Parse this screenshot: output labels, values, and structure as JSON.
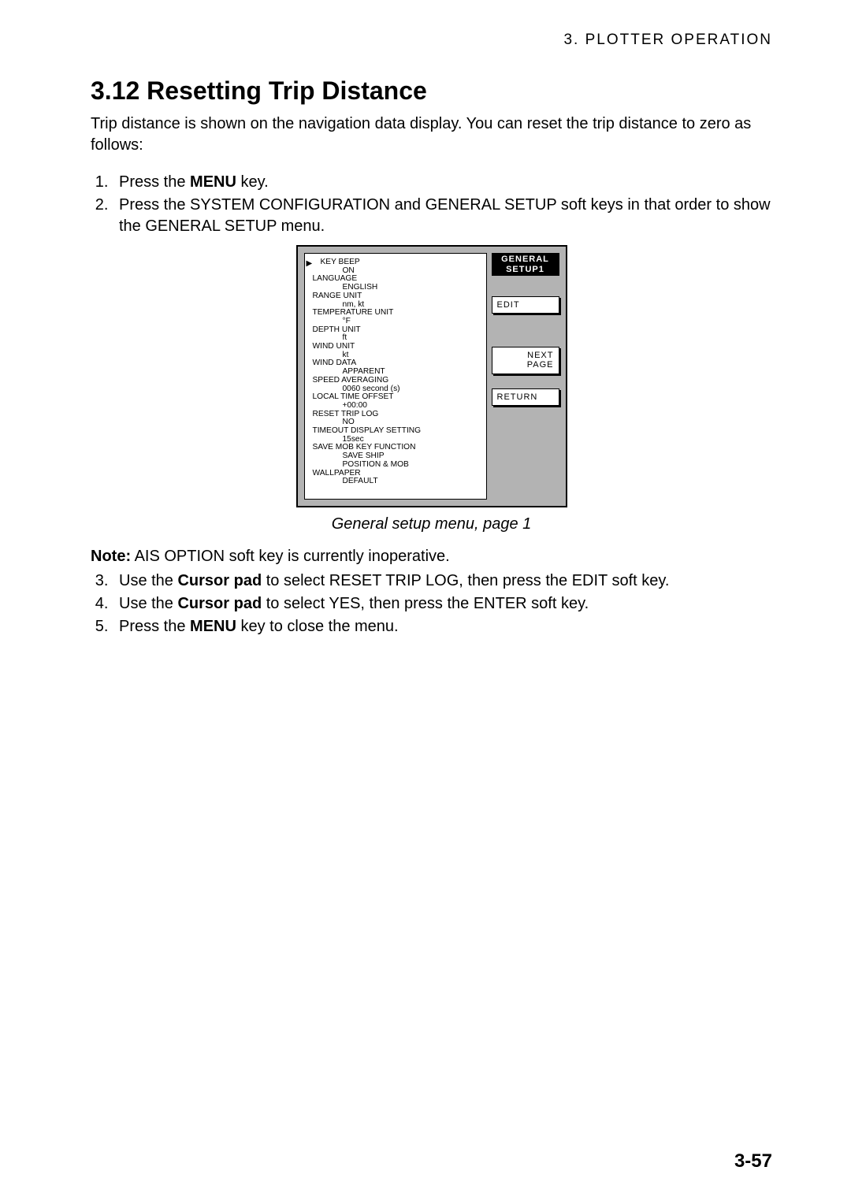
{
  "header": {
    "running": "3. PLOTTER OPERATION"
  },
  "section": {
    "heading": "3.12  Resetting Trip Distance",
    "intro": "Trip distance is shown on the navigation data display. You can reset the trip distance to zero as follows:"
  },
  "steps_a": {
    "s1_pre": "Press the ",
    "s1_bold": "MENU",
    "s1_post": " key.",
    "s2": "Press the SYSTEM CONFIGURATION and GENERAL SETUP soft keys in that order to show the GENERAL SETUP menu."
  },
  "diagram": {
    "title_line1": "GENERAL",
    "title_line2": "SETUP1",
    "softkeys": {
      "edit": "EDIT",
      "next1": "NEXT",
      "next2": "PAGE",
      "return": "RETURN"
    },
    "menu": {
      "i0": {
        "label": "KEY BEEP",
        "value": "ON"
      },
      "i1": {
        "label": "LANGUAGE",
        "value": "ENGLISH"
      },
      "i2": {
        "label": "RANGE UNIT",
        "value": "nm, kt"
      },
      "i3": {
        "label": "TEMPERATURE UNIT",
        "value": "°F"
      },
      "i4": {
        "label": "DEPTH UNIT",
        "value": "ft"
      },
      "i5": {
        "label": "WIND UNIT",
        "value": "kt"
      },
      "i6": {
        "label": "WIND DATA",
        "value": "APPARENT"
      },
      "i7": {
        "label": "SPEED AVERAGING",
        "value": "0060 second (s)"
      },
      "i8": {
        "label": "LOCAL TIME OFFSET",
        "value": "+00:00"
      },
      "i9": {
        "label": "RESET TRIP LOG",
        "value": "NO"
      },
      "i10": {
        "label": "TIMEOUT DISPLAY SETTING",
        "value": "15sec"
      },
      "i11": {
        "label": "SAVE MOB KEY FUNCTION",
        "value1": "SAVE SHIP",
        "value2": "POSITION & MOB"
      },
      "i12": {
        "label": "WALLPAPER",
        "value": "DEFAULT"
      }
    },
    "caption": "General setup menu, page 1"
  },
  "note": {
    "bold": "Note:",
    "text": " AIS OPTION soft key is currently inoperative."
  },
  "steps_b": {
    "s3_pre": "Use the ",
    "s3_bold": "Cursor pad",
    "s3_post": " to select RESET TRIP LOG, then press the EDIT soft key.",
    "s4_pre": "Use the ",
    "s4_bold": "Cursor pad",
    "s4_post": " to select YES, then press the ENTER soft key.",
    "s5_pre": "Press the ",
    "s5_bold": "MENU",
    "s5_post": " key to close the menu."
  },
  "footer": {
    "page_number": "3-57"
  }
}
